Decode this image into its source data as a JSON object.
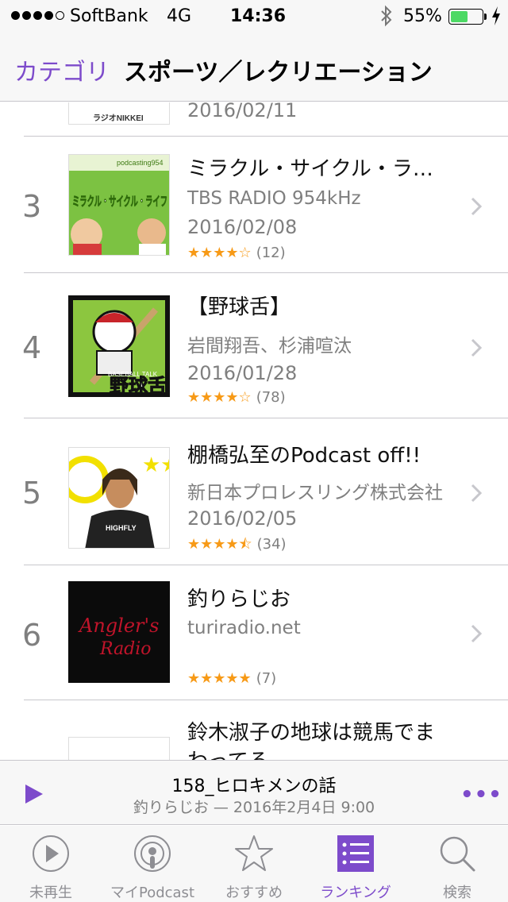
{
  "status_bar": {
    "carrier": "SoftBank",
    "network": "4G",
    "time": "14:36",
    "battery": "55%",
    "battery_level": 0.55
  },
  "nav": {
    "back_label": "カテゴリ",
    "title": "スポーツ／レクリエーション"
  },
  "list": {
    "partial_top": {
      "date": "2016/02/11",
      "logo_text": "ラジオNIKKEI"
    },
    "items": [
      {
        "rank": "3",
        "title": "ミラクル・サイクル・ラ…",
        "artist": "TBS RADIO 954kHz",
        "date": "2016/02/08",
        "stars": "★★★★☆",
        "rating": 4,
        "count": "(12)",
        "art_text_top": "podcasting954",
        "art_text": "ミラクル・サイクル・ライフ"
      },
      {
        "rank": "4",
        "title": "【野球舌】",
        "artist": "岩間翔吾、杉浦喧汰",
        "date": "2016/01/28",
        "stars": "★★★★☆",
        "rating": 4,
        "count": "(78)",
        "art_text_top": "BASEBALL TALK",
        "art_text": "野球舌"
      },
      {
        "rank": "5",
        "title": "棚橋弘至のPodcast off!!",
        "artist": "新日本プロレスリング株式会社",
        "date": "2016/02/05",
        "stars": "★★★★⯪",
        "rating": 4.5,
        "count": "(34)",
        "art_text": "HIGHFLY"
      },
      {
        "rank": "6",
        "title": "釣りらじお",
        "artist": "turiradio.net",
        "date": "",
        "stars": "★★★★★",
        "rating": 5,
        "count": "(7)",
        "art_text": "Angler's",
        "art_text2": "Radio"
      },
      {
        "rank": "",
        "title_line1": "鈴木淑子の地球は競馬でま",
        "title_line2": "わってる"
      }
    ]
  },
  "player": {
    "title": "158_ヒロキメンの話",
    "subtitle": "釣りらじお — 2016年2月4日 9:00",
    "more": "•••"
  },
  "tabs": [
    {
      "label": "未再生",
      "icon": "play-circle-icon",
      "active": false
    },
    {
      "label": "マイPodcast",
      "icon": "podcast-icon",
      "active": false
    },
    {
      "label": "おすすめ",
      "icon": "star-icon",
      "active": false
    },
    {
      "label": "ランキング",
      "icon": "ranking-list-icon",
      "active": true
    },
    {
      "label": "検索",
      "icon": "search-icon",
      "active": false
    }
  ],
  "colors": {
    "accent": "#7d4bcb",
    "star": "#f79a17",
    "battery": "#4cd964"
  }
}
